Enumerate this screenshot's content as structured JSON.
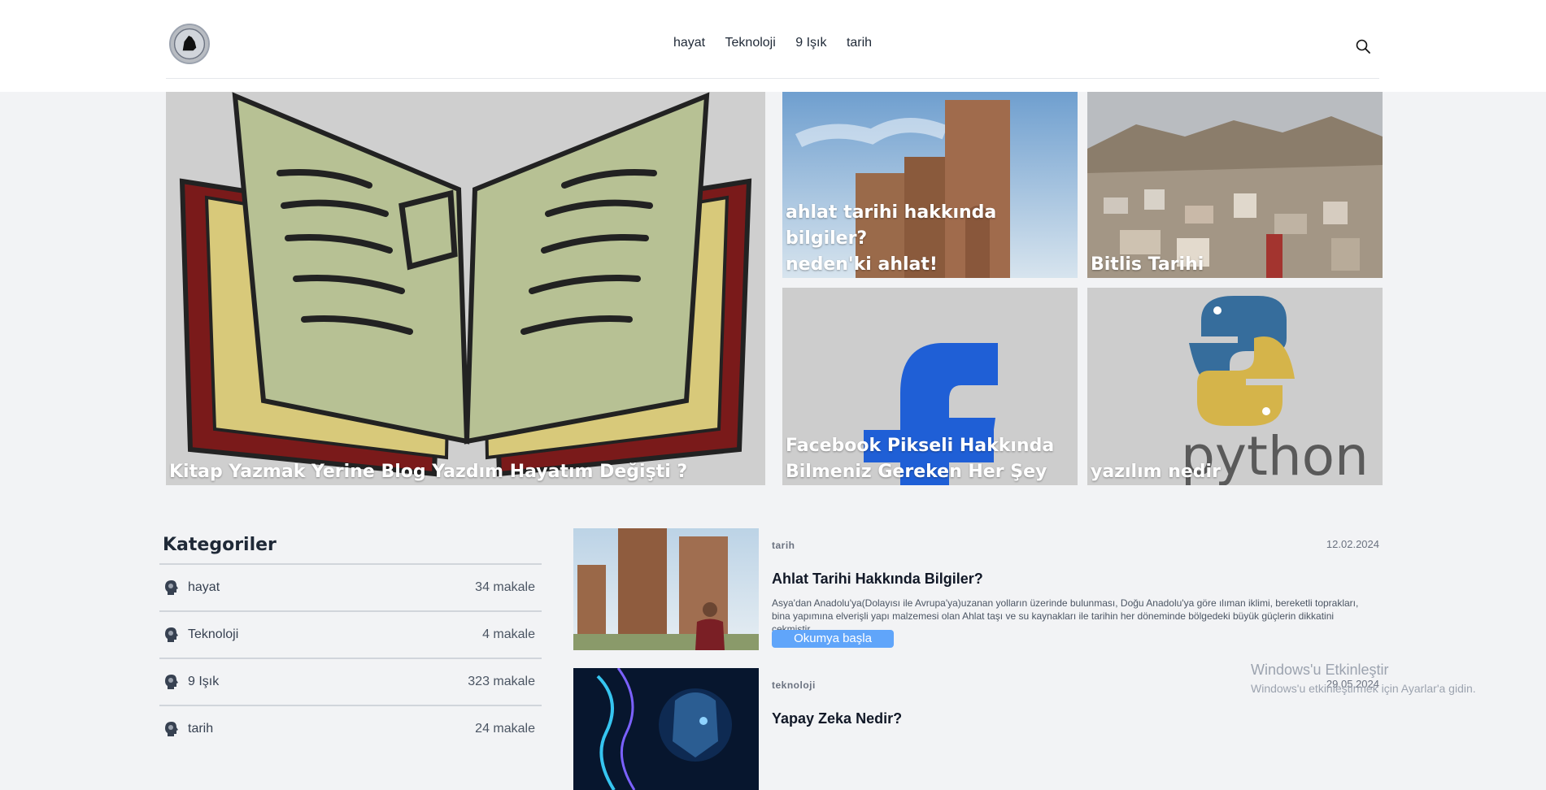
{
  "nav": {
    "items": [
      "hayat",
      "Teknoloji",
      "9 Işık",
      "tarih"
    ]
  },
  "featured": {
    "main": {
      "title": "Kitap Yazmak Yerine Blog Yazdım Hayatım Değişti ?"
    },
    "ahlat": {
      "title_line1": "ahlat tarihi hakkında bilgiler?",
      "title_line2": "neden'ki ahlat!"
    },
    "bitlis": {
      "title": "Bitlis Tarihi"
    },
    "facebook": {
      "title_line1": "Facebook Pikseli Hakkında",
      "title_line2": "Bilmeniz Gereken Her Şey"
    },
    "python": {
      "title": "yazılım nedir",
      "logo_text": "python"
    }
  },
  "sidebar": {
    "heading": "Kategoriler",
    "categories": [
      {
        "name": "hayat",
        "count": "34 makale"
      },
      {
        "name": "Teknoloji",
        "count": "4 makale"
      },
      {
        "name": "9 Işık",
        "count": "323 makale"
      },
      {
        "name": "tarih",
        "count": "24 makale"
      }
    ]
  },
  "posts": [
    {
      "category": "tarih",
      "date": "12.02.2024",
      "title": "Ahlat Tarihi Hakkında Bilgiler?",
      "description": "Asya'dan Anadolu'ya(Dolayısı ile Avrupa'ya)uzanan yolların üzerinde bulunması, Doğu Anadolu'ya göre ılıman iklimi, bereketli toprakları, bina yapımına elverişli yapı malzemesi olan Ahlat taşı ve su kaynakları ile tarihin her döneminde bölgedeki büyük güçlerin dikkatini çekmiştir.",
      "button": "Okumya başla"
    },
    {
      "category": "teknoloji",
      "date": "29.05.2024",
      "title": "Yapay Zeka Nedir?"
    }
  ],
  "watermark": {
    "title": "Windows'u Etkinleştir",
    "subtitle": "Windows'u etkinleştirmek için Ayarlar'a gidin."
  }
}
